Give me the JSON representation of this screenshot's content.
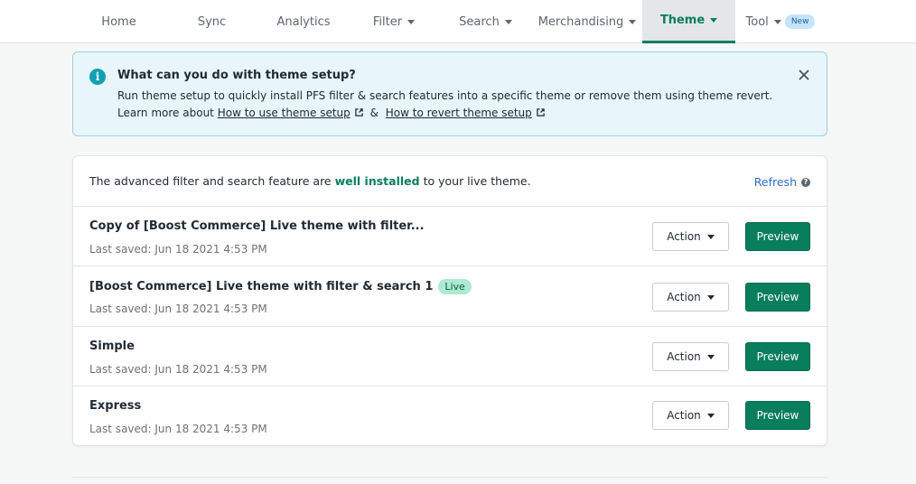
{
  "nav": {
    "tabs": [
      {
        "label": "Home",
        "dropdown": false,
        "active": false
      },
      {
        "label": "Sync",
        "dropdown": false,
        "active": false
      },
      {
        "label": "Analytics",
        "dropdown": false,
        "active": false
      },
      {
        "label": "Filter",
        "dropdown": true,
        "active": false
      },
      {
        "label": "Search",
        "dropdown": true,
        "active": false
      },
      {
        "label": "Merchandising",
        "dropdown": true,
        "active": false
      },
      {
        "label": "Theme",
        "dropdown": true,
        "active": true
      },
      {
        "label": "Tool",
        "dropdown": true,
        "active": false,
        "badge": "New"
      }
    ]
  },
  "banner": {
    "icon": "info-icon",
    "title": "What can you do with theme setup?",
    "line1": "Run theme setup to quickly install PFS filter & search features into a specific theme or remove them using theme revert.",
    "line2_prefix": "Learn more about",
    "link1": "How to use theme setup",
    "separator": "&",
    "link2": "How to revert theme setup",
    "close_icon": "close-icon"
  },
  "status": {
    "prefix": "The advanced filter and search feature are",
    "highlight": "well installed",
    "suffix": "to your live theme.",
    "refresh_label": "Refresh",
    "help_glyph": "?"
  },
  "themes": [
    {
      "name": "Copy of [Boost Commerce] Live theme with filter...",
      "saved": "Last saved: Jun 18 2021 4:53 PM",
      "live": false,
      "action_label": "Action",
      "preview_label": "Preview"
    },
    {
      "name": "[Boost Commerce] Live theme with filter & search 1",
      "saved": "Last saved: Jun 18 2021 4:53 PM",
      "live": true,
      "live_label": "Live",
      "action_label": "Action",
      "preview_label": "Preview"
    },
    {
      "name": "Simple",
      "saved": "Last saved: Jun 18 2021 4:53 PM",
      "live": false,
      "action_label": "Action",
      "preview_label": "Preview"
    },
    {
      "name": "Express",
      "saved": "Last saved: Jun 18 2021 4:53 PM",
      "live": false,
      "action_label": "Action",
      "preview_label": "Preview"
    }
  ],
  "colors": {
    "accent": "#087e5c",
    "banner_bg": "#e8f6fb",
    "link": "#2c6ecb",
    "live_badge": "#aee9d1",
    "new_badge": "#c5e4fb"
  }
}
